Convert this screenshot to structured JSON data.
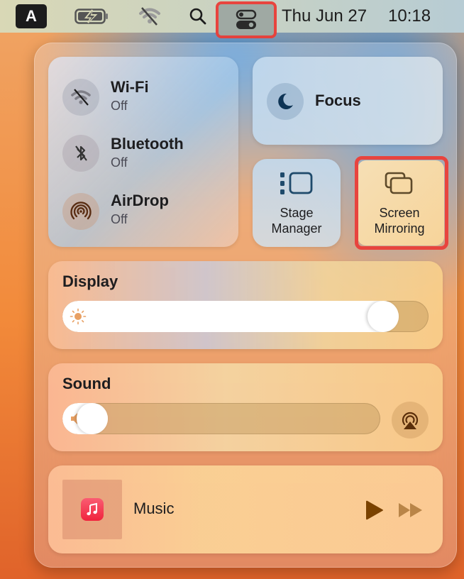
{
  "menubar": {
    "input_source": "A",
    "icons": [
      "keyboard-input-icon",
      "battery-charging-icon",
      "wifi-off-icon",
      "spotlight-search-icon",
      "control-center-icon"
    ],
    "date": "Thu Jun 27",
    "time": "10:18"
  },
  "control_center": {
    "connectivity": [
      {
        "label": "Wi-Fi",
        "status": "Off",
        "icon": "wifi-off-icon"
      },
      {
        "label": "Bluetooth",
        "status": "Off",
        "icon": "bluetooth-off-icon"
      },
      {
        "label": "AirDrop",
        "status": "Off",
        "icon": "airdrop-icon"
      }
    ],
    "focus": {
      "label": "Focus",
      "icon": "moon-icon"
    },
    "stage_manager": {
      "label_line1": "Stage",
      "label_line2": "Manager",
      "icon": "stage-manager-icon"
    },
    "screen_mirroring": {
      "label_line1": "Screen",
      "label_line2": "Mirroring",
      "icon": "screen-mirroring-icon",
      "highlighted": true
    },
    "display": {
      "title": "Display",
      "brightness_percent": 91,
      "icon": "sun-icon"
    },
    "sound": {
      "title": "Sound",
      "volume_percent": 5,
      "icon": "speaker-icon",
      "output_icon": "airplay-audio-icon"
    },
    "now_playing": {
      "app": "Music",
      "icon": "music-app-icon",
      "controls": [
        "play",
        "fast-forward"
      ]
    }
  },
  "colors": {
    "highlight_outline": "#e8443e",
    "focus_icon": "#0e3455",
    "music_icon": "#f53a52"
  }
}
